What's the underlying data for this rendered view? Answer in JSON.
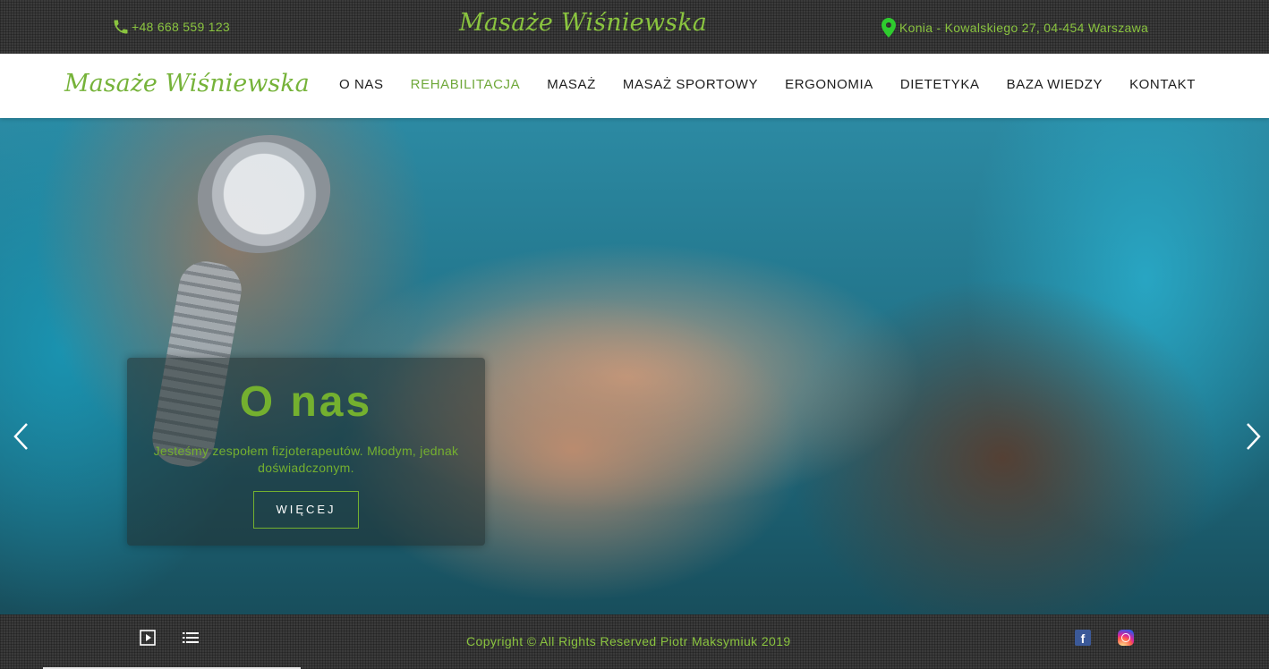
{
  "topbar": {
    "phone": "+48 668 559 123",
    "brand": "Masaże Wiśniewska",
    "address": "Konia - Kowalskiego 27, 04-454 Warszawa"
  },
  "navbar": {
    "logo": "Masaże Wiśniewska",
    "items": [
      {
        "label": "O NAS",
        "active": false
      },
      {
        "label": "REHABILITACJA",
        "active": true
      },
      {
        "label": "MASAŻ",
        "active": false
      },
      {
        "label": "MASAŻ SPORTOWY",
        "active": false
      },
      {
        "label": "ERGONOMIA",
        "active": false
      },
      {
        "label": "DIETETYKA",
        "active": false
      },
      {
        "label": "BAZA WIEDZY",
        "active": false
      },
      {
        "label": "KONTAKT",
        "active": false
      }
    ]
  },
  "hero": {
    "title": "O nas",
    "text": "Jesteśmy zespołem fizjoterapeutów. Młodym, jednak doświadczonym.",
    "button": "WIĘCEJ",
    "prev_icon": "chevron-left-icon",
    "next_icon": "chevron-right-icon"
  },
  "footer": {
    "copyright": "Copyright © All Rights Reserved Piotr Maksymiuk 2019",
    "play_icon": "play-icon",
    "list_icon": "list-icon",
    "facebook_glyph": "f",
    "social": [
      "facebook-icon",
      "instagram-icon"
    ]
  },
  "colors": {
    "accent": "#8ac43f",
    "active_nav": "#6fa83a",
    "dark_bar": "#3b3b3b",
    "facebook": "#3b5998"
  }
}
